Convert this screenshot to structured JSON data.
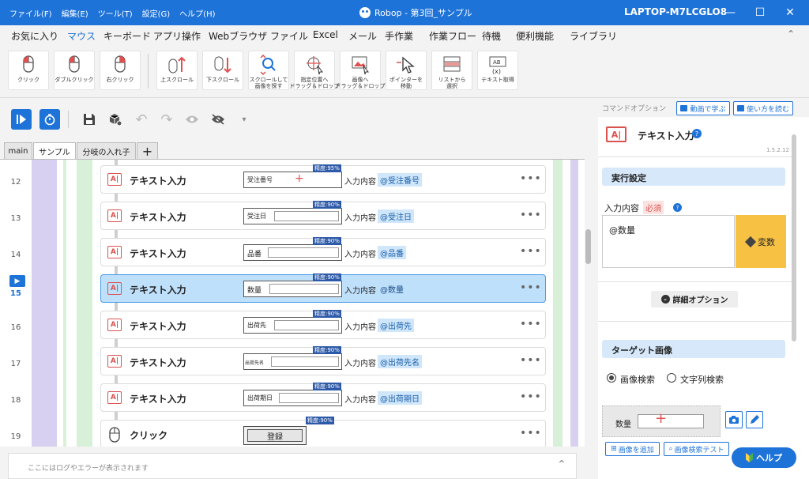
{
  "titlebar": {
    "menus": [
      "ファイル(F)",
      "編集(E)",
      "ツール(T)",
      "設定(G)",
      "ヘルプ(H)"
    ],
    "title": "Robop - 第3回_サンプル",
    "hostname": "LAPTOP-M7LCGLO8",
    "minimize": "—",
    "maximize": "☐",
    "close": "✕"
  },
  "ribbon_tabs": [
    "お気に入り",
    "マウス",
    "キーボード",
    "アプリ操作",
    "Webブラウザ",
    "ファイル",
    "Excel",
    "メール",
    "手作業",
    "作業フロー",
    "待機",
    "便利機能",
    "ライブラリ"
  ],
  "ribbon_buttons": [
    {
      "label": "クリック",
      "icon": "mouse-click-icon"
    },
    {
      "label": "ダブルクリック",
      "icon": "mouse-double-click-icon"
    },
    {
      "label": "右クリック",
      "icon": "mouse-right-click-icon"
    },
    {
      "label": "上スクロール",
      "icon": "scroll-up-icon"
    },
    {
      "label": "下スクロール",
      "icon": "scroll-down-icon"
    },
    {
      "label": "スクロールして\n画像を探す",
      "icon": "scroll-search-image-icon"
    },
    {
      "label": "指定位置へ\nドラッグ＆ドロップ",
      "icon": "drag-to-position-icon"
    },
    {
      "label": "画像へ\nドラッグ＆ドロップ",
      "icon": "drag-to-image-icon"
    },
    {
      "label": "ポインターを\n移動",
      "icon": "pointer-move-icon"
    },
    {
      "label": "リストから\n選択",
      "icon": "list-select-icon"
    },
    {
      "label": "テキスト取得",
      "icon": "text-get-icon"
    }
  ],
  "doc_tabs": [
    "main",
    "サンプル",
    "分岐の入れ子"
  ],
  "active_doc_tab": "サンプル",
  "rows": [
    {
      "num": "12",
      "name": "テキスト入力",
      "thumb_label": "受注番号",
      "confidence": "精度:95%",
      "input_label": "入力内容",
      "variable": "@受注番号",
      "active": false
    },
    {
      "num": "13",
      "name": "テキスト入力",
      "thumb_label": "受注日",
      "confidence": "精度:90%",
      "input_label": "入力内容",
      "variable": "@受注日",
      "active": false
    },
    {
      "num": "14",
      "name": "テキスト入力",
      "thumb_label": "品番",
      "confidence": "精度:90%",
      "input_label": "入力内容",
      "variable": "@品番",
      "active": false
    },
    {
      "num": "15",
      "name": "テキスト入力",
      "thumb_label": "数量",
      "confidence": "精度:90%",
      "input_label": "入力内容",
      "variable": "@数量",
      "active": true
    },
    {
      "num": "16",
      "name": "テキスト入力",
      "thumb_label": "出荷先",
      "confidence": "精度:90%",
      "input_label": "入力内容",
      "variable": "@出荷先",
      "active": false
    },
    {
      "num": "17",
      "name": "テキスト入力",
      "thumb_label": "出荷先名",
      "confidence": "精度:90%",
      "input_label": "入力内容",
      "variable": "@出荷先名",
      "active": false
    },
    {
      "num": "18",
      "name": "テキスト入力",
      "thumb_label": "出荷期日",
      "confidence": "精度:90%",
      "input_label": "入力内容",
      "variable": "@出荷期日",
      "active": false
    },
    {
      "num": "19",
      "name": "クリック",
      "thumb_label": "登録",
      "confidence": "精度:90%",
      "input_label": "",
      "variable": "",
      "active": false
    }
  ],
  "log_placeholder": "ここにはログやエラーが表示されます",
  "panel": {
    "header": "コマンドオプション",
    "learn_video": "動画で学ぶ",
    "how_to_read": "使い方を読む",
    "command_title": "テキスト入力",
    "version": "1.5.2.12",
    "exec_settings": "実行設定",
    "input_content_label": "入力内容",
    "required": "必須",
    "input_value": "@数量",
    "variable_button": "変数",
    "detail_options": "詳細オプション",
    "target_image": "ターゲット画像",
    "radio_image": "画像検索",
    "radio_text": "文字列検索",
    "target_thumb_label": "数量",
    "add_image": "画像を追加",
    "test_image": "画像検索テスト",
    "help": "ヘルプ"
  },
  "colors": {
    "titlebar": "#1e73d8",
    "accent": "#1e73d8",
    "active_row": "#bfe0fb",
    "badge": "#2d5aa8",
    "variable_button": "#f7c244",
    "section_header": "#d6e8fa"
  }
}
